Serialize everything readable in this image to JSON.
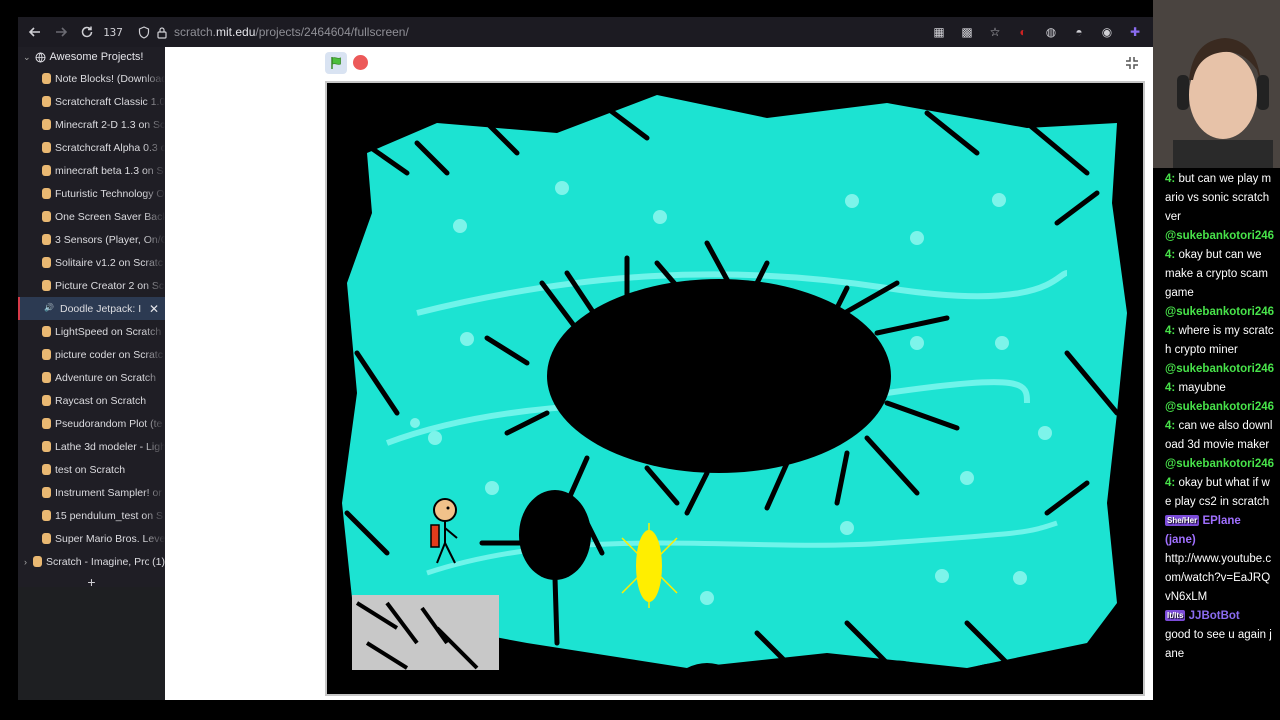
{
  "browser": {
    "tab_count": "137",
    "url_host": "scratch.",
    "url_domain": "mit.edu",
    "url_path": "/projects/2464604/fullscreen/"
  },
  "sidebar": {
    "group_name": "Awesome Projects!",
    "tabs": [
      {
        "label": "Note Blocks! (Download"
      },
      {
        "label": "Scratchcraft Classic 1.0"
      },
      {
        "label": "Minecraft 2-D 1.3 on Sc"
      },
      {
        "label": "Scratchcraft Alpha 0.3 o"
      },
      {
        "label": "minecraft beta 1.3 on S"
      },
      {
        "label": "Futuristic Technology O"
      },
      {
        "label": "One Screen Saver Back"
      },
      {
        "label": "3 Sensors (Player, On/O"
      },
      {
        "label": "Solitaire v1.2 on Scratc"
      },
      {
        "label": "Picture Creator 2 on Sc"
      },
      {
        "label": "Doodle Jetpack: I"
      },
      {
        "label": "LightSpeed on Scratch"
      },
      {
        "label": "picture coder on Scratc"
      },
      {
        "label": "Adventure on Scratch"
      },
      {
        "label": "Raycast on Scratch"
      },
      {
        "label": "Pseudorandom Plot (te"
      },
      {
        "label": "Lathe 3d modeler - Ligh"
      },
      {
        "label": "test on Scratch"
      },
      {
        "label": "Instrument Sampler! or"
      },
      {
        "label": "15 pendulum_test on S"
      },
      {
        "label": "Super Mario Bros. Leve"
      }
    ],
    "active_index": 10,
    "other_tab_label": "Scratch - Imagine, Proc",
    "other_tab_count": "(1)"
  },
  "chat": {
    "messages": [
      {
        "user": "",
        "text": "but can we play mario vs sonic scratch ver"
      },
      {
        "user": "@sukebankotori246",
        "text": "okay but can we make a crypto scam game"
      },
      {
        "user": "@sukebankotori246",
        "text": "where is my scratch crypto miner"
      },
      {
        "user": "@sukebankotori246",
        "text": "mayubne"
      },
      {
        "user": "@sukebankotori246",
        "text": "can we also download 3d movie maker"
      },
      {
        "user": "@sukebankotori246",
        "text": "okay but what if we play cs2 in scratch"
      },
      {
        "user": "EPlane (jane)",
        "text": "http://www.youtube.com/watch?v=EaJRQvN6xLM"
      },
      {
        "user": "JJBotBot",
        "text": "good to see u again jane"
      }
    ],
    "prefix": "4:",
    "badge_pronoun": "She/Her",
    "badge_it": "It/Its",
    "colors": {
      "sukeban": "#48e34a",
      "eplane": "#a070ff",
      "jjbot": "#8a6cf0"
    }
  }
}
